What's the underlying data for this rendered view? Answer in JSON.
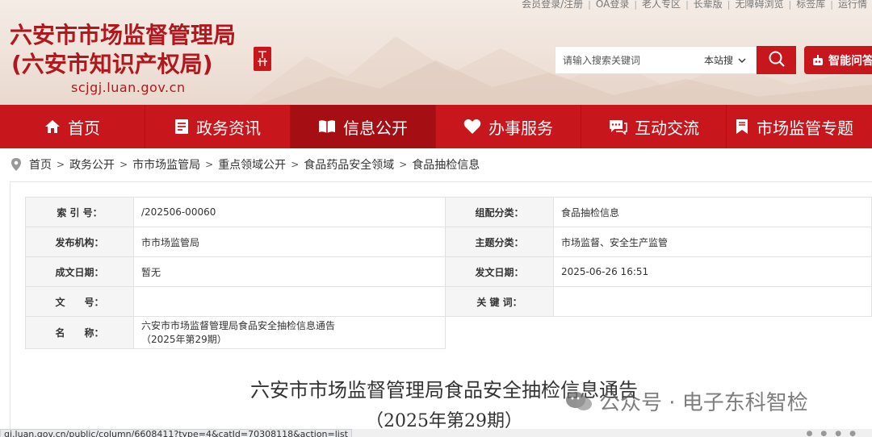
{
  "top_links": [
    "会员登录/注册",
    "OA登录",
    "老人专区",
    "长辈版",
    "无障碍浏览",
    "标签库",
    "运行情"
  ],
  "site": {
    "title": "六安市市场监督管理局",
    "subtitle": "(六安市知识产权局)",
    "domain": "scjgj.luan.gov.cn"
  },
  "search": {
    "placeholder": "请输入搜索关键词",
    "scope": "本站搜",
    "ai_label": "智能问答"
  },
  "nav": {
    "items": [
      {
        "label": "首页",
        "icon": "home-icon"
      },
      {
        "label": "政务资讯",
        "icon": "document-icon"
      },
      {
        "label": "信息公开",
        "icon": "open-book-icon"
      },
      {
        "label": "办事服务",
        "icon": "heart-icon"
      },
      {
        "label": "互动交流",
        "icon": "chat-icon"
      },
      {
        "label": "市场监管专题",
        "icon": "bookmark-icon"
      }
    ],
    "active_index": 2
  },
  "breadcrumb": [
    "首页",
    "政务公开",
    "市市场监管局",
    "重点领域公开",
    "食品药品安全领域",
    "食品抽检信息"
  ],
  "meta": {
    "index_label": "索 引 号：",
    "index_value": "/202506-00060",
    "category_label": "组配分类：",
    "category_value": "食品抽检信息",
    "publisher_label": "发布机构：",
    "publisher_value": "市市场监管局",
    "topic_label": "主题分类：",
    "topic_value": "市场监督、安全生产监管",
    "created_label": "成文日期：",
    "created_value": "暂无",
    "published_label": "发文日期：",
    "published_value": "2025-06-26 16:51",
    "docno_label": "文　　号：",
    "docno_value": "",
    "keywords_label": "关 键 词：",
    "keywords_value": "",
    "name_label": "名　　称：",
    "name_value_line1": "六安市市场监督管理局食品安全抽检信息通告",
    "name_value_line2": "（2025年第29期）"
  },
  "document": {
    "title": "六安市市场监督管理局食品安全抽检信息通告",
    "subtitle": "（2025年第29期）"
  },
  "watermark": "公众号 · 电子东科智检",
  "status_url": "gj.luan.gov.cn/public/column/6608411?type=4&catId=70308118&action=list",
  "colors": {
    "brand_red": "#c8161d",
    "nav_active": "#a50f14",
    "label_bg": "#f5f5f5"
  }
}
